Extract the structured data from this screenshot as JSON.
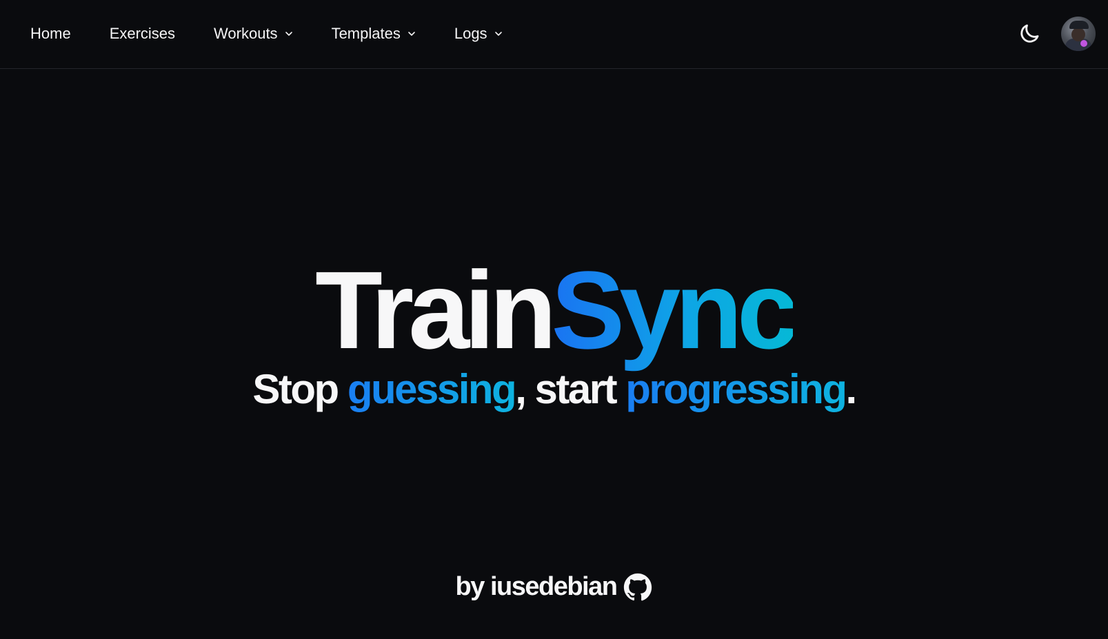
{
  "nav": {
    "items": [
      {
        "label": "Home",
        "has_dropdown": false
      },
      {
        "label": "Exercises",
        "has_dropdown": false
      },
      {
        "label": "Workouts",
        "has_dropdown": true
      },
      {
        "label": "Templates",
        "has_dropdown": true
      },
      {
        "label": "Logs",
        "has_dropdown": true
      }
    ]
  },
  "header_controls": {
    "theme_icon": "moon-icon",
    "avatar_icon": "user-avatar"
  },
  "hero": {
    "title_part1": "Train",
    "title_part2": "Sync",
    "tagline": {
      "w1": "Stop ",
      "g1": "guessing",
      "w2": ", start ",
      "g2": "progressing",
      "w3": "."
    }
  },
  "footer": {
    "by_text": "by iusedebian",
    "icon": "github-icon"
  },
  "colors": {
    "background": "#0a0b0e",
    "text": "#f7f7f8",
    "accent_start": "#1a73f2",
    "accent_end": "#06b8d6"
  }
}
